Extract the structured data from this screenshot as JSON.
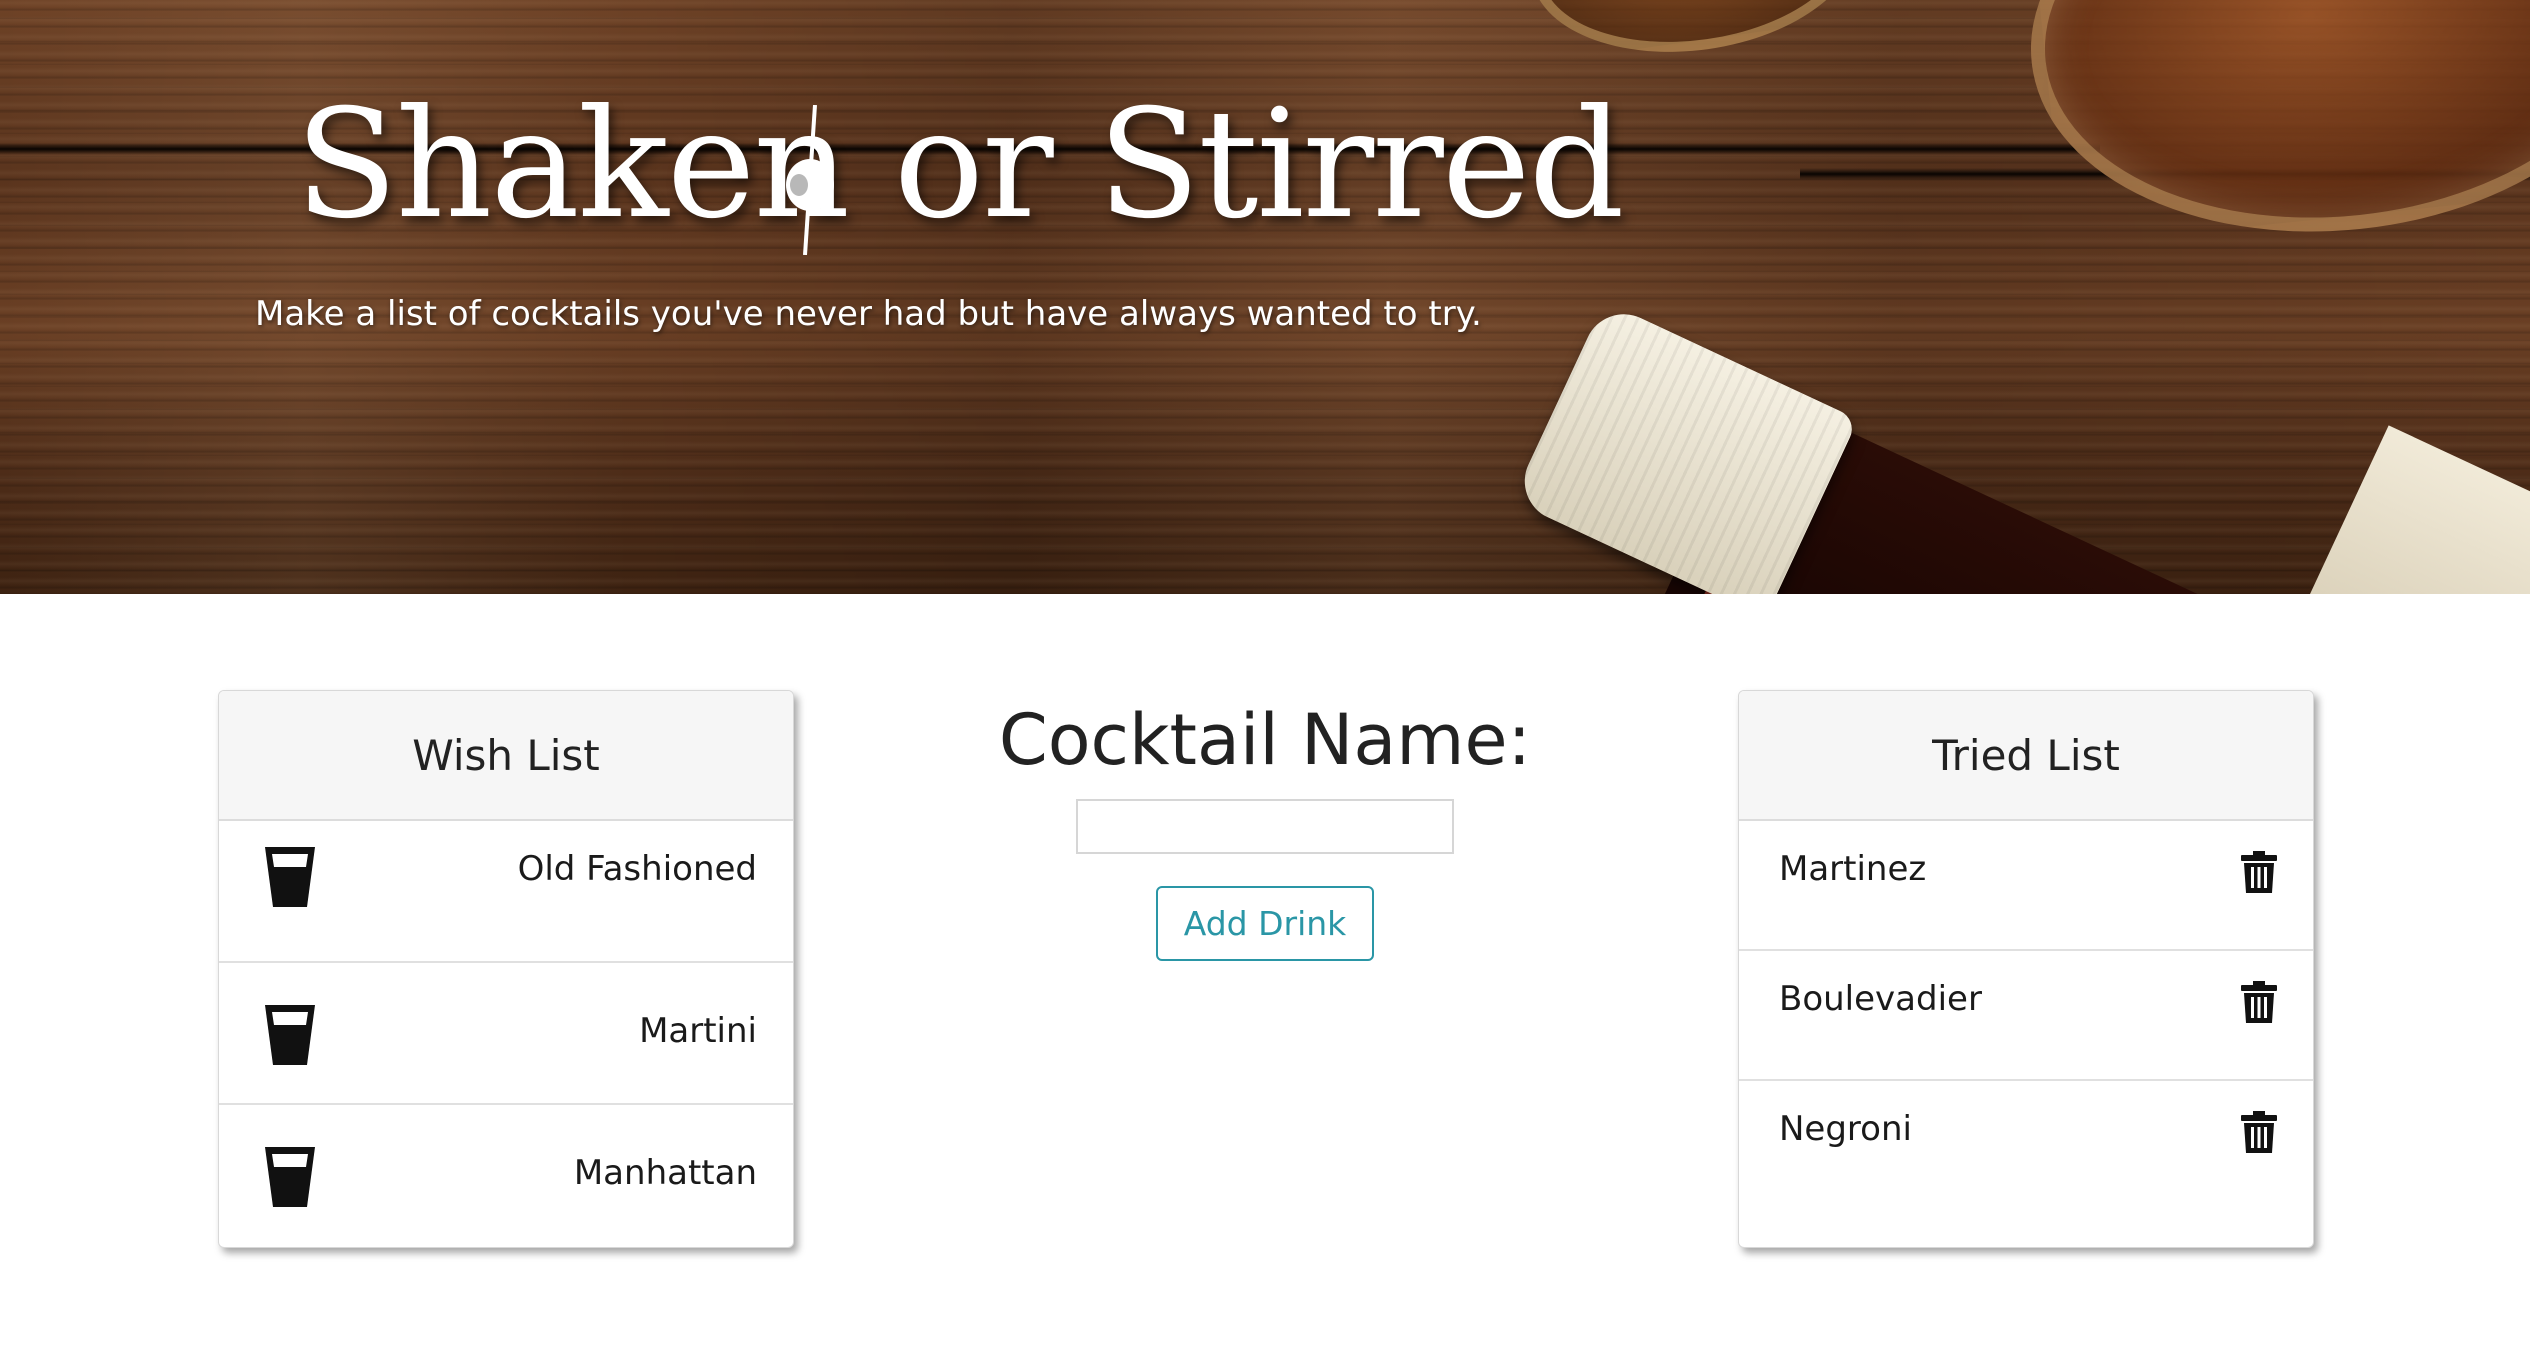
{
  "header": {
    "title": "Shaken or Stirred",
    "tagline": "Make a list of cocktails you've never had but have always wanted to try."
  },
  "wish_list": {
    "heading": "Wish List",
    "items": [
      {
        "name": "Old Fashioned",
        "icon": "cup-icon"
      },
      {
        "name": "Martini",
        "icon": "cup-icon"
      },
      {
        "name": "Manhattan",
        "icon": "cup-icon"
      }
    ]
  },
  "form": {
    "label": "Cocktail Name:",
    "input_value": "",
    "button_label": "Add Drink",
    "accent_color": "#2a96a6"
  },
  "tried_list": {
    "heading": "Tried List",
    "items": [
      {
        "name": "Martinez",
        "icon": "trash-icon"
      },
      {
        "name": "Boulevadier",
        "icon": "trash-icon"
      },
      {
        "name": "Negroni",
        "icon": "trash-icon"
      }
    ]
  }
}
